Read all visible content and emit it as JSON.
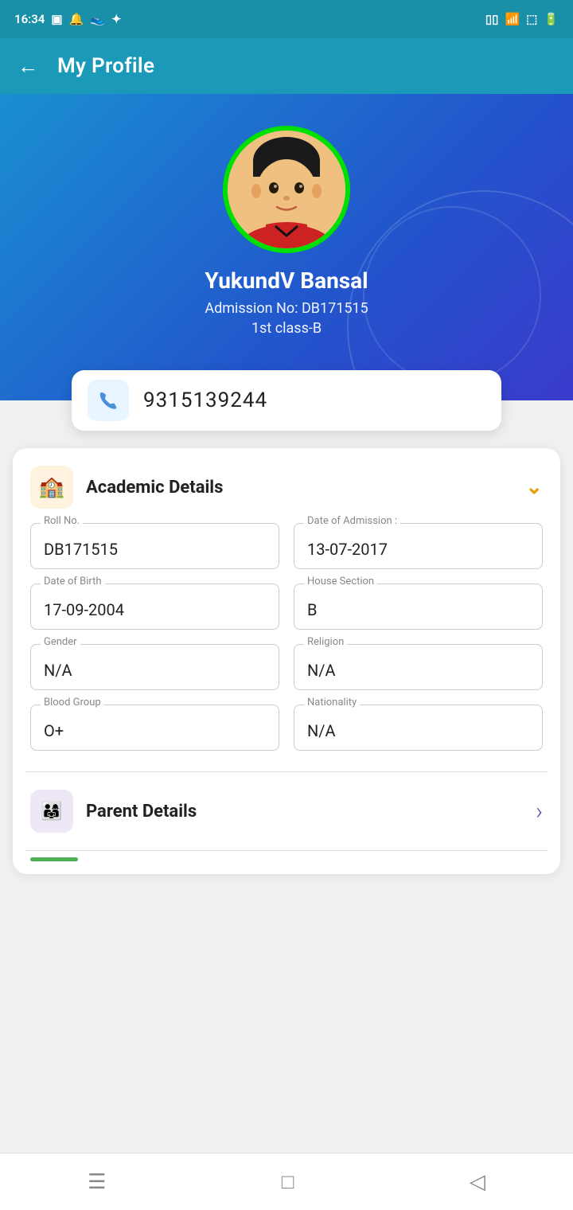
{
  "statusBar": {
    "time": "16:34",
    "icons": [
      "sim",
      "notification1",
      "notification2",
      "bluetooth"
    ]
  },
  "appBar": {
    "backLabel": "←",
    "title": "My Profile"
  },
  "profile": {
    "name": "YukundV Bansal",
    "admissionLabel": "Admission No: DB171515",
    "classLabel": "1st class-B",
    "phone": "9315139244"
  },
  "academicSection": {
    "title": "Academic Details",
    "iconEmoji": "🏫",
    "chevron": "∨",
    "fields": [
      {
        "label": "Roll No.",
        "value": "DB171515"
      },
      {
        "label": "Date of Admission :",
        "value": "13-07-2017"
      },
      {
        "label": "Date of Birth",
        "value": "17-09-2004"
      },
      {
        "label": "House Section",
        "value": "B"
      },
      {
        "label": "Gender",
        "value": "N/A"
      },
      {
        "label": "Religion",
        "value": "N/A"
      },
      {
        "label": "Blood Group",
        "value": "O+"
      },
      {
        "label": "Nationality",
        "value": "N/A"
      }
    ]
  },
  "parentSection": {
    "title": "Parent Details",
    "iconEmoji": "👨‍👩‍👧",
    "chevron": "›"
  },
  "bottomNav": {
    "icons": [
      "≡",
      "□",
      "◁"
    ]
  }
}
